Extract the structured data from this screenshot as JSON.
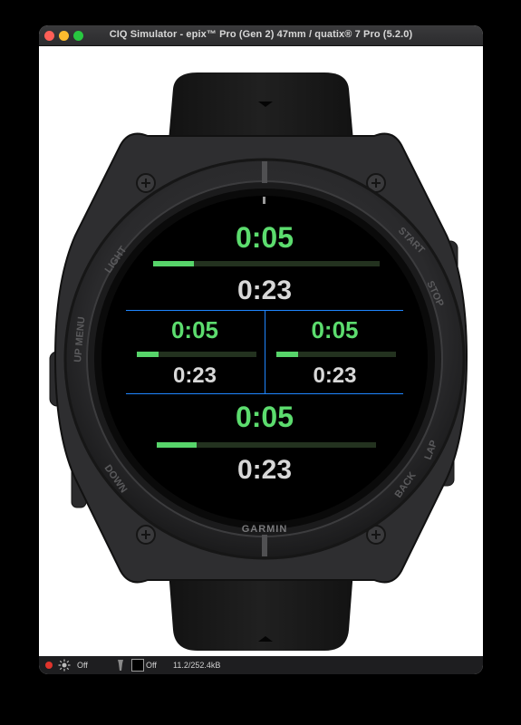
{
  "window": {
    "title": "CIQ Simulator - epix™ Pro (Gen 2) 47mm / quatix® 7 Pro (5.2.0)"
  },
  "watch": {
    "brand": "GARMIN",
    "bezel_labels": {
      "light": "LIGHT",
      "up_menu": "UP MENU",
      "down": "DOWN",
      "start": "START",
      "stop": "STOP",
      "back": "BACK",
      "lap": "LAP"
    },
    "colors": {
      "timer": "#5cdc6e",
      "divider": "#1f86ff",
      "bar_fill": "#57d46a"
    },
    "fields": {
      "top": {
        "timer": "0:05",
        "elapsed": "0:23",
        "progress": 0.18
      },
      "middle_left": {
        "timer": "0:05",
        "elapsed": "0:23",
        "progress": 0.18
      },
      "middle_right": {
        "timer": "0:05",
        "elapsed": "0:23",
        "progress": 0.18
      },
      "bottom": {
        "timer": "0:05",
        "elapsed": "0:23",
        "progress": 0.18
      }
    }
  },
  "status_bar": {
    "backlight_state": "Off",
    "flashlight_state": "Off",
    "memory": "11.2/252.4kB"
  }
}
